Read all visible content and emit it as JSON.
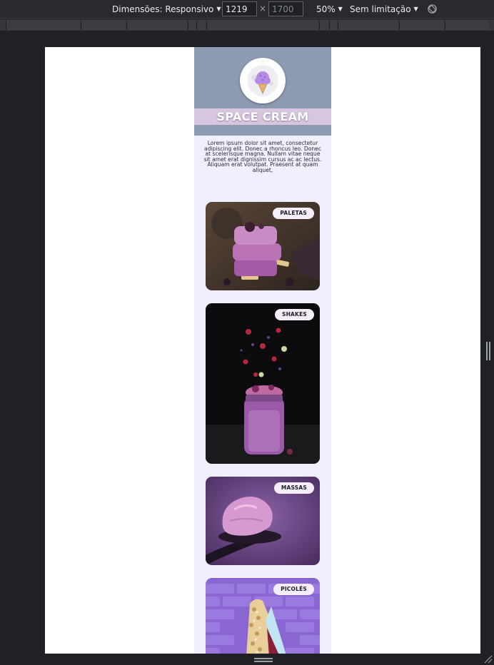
{
  "devtools": {
    "dimensions_label": "Dimensões: Responsivo",
    "width_value": "1219",
    "height_placeholder": "1700",
    "times": "×",
    "zoom": "50%",
    "throttle": "Sem limitação"
  },
  "site": {
    "brand": "SPACE CREAM",
    "intro": "Lorem ipsum dolor sit amet, consectetur adipiscing elit. Donec a rhoncus leo. Donec at scelerisque magna. Nullam vitae neque sit amet erat dignissim cursus ac ac lectus. Aliquam erat volutpat. Praesent at quam aliquet,",
    "categories": [
      {
        "label": "PALETAS",
        "photo": "popsicle-photo"
      },
      {
        "label": "SHAKES",
        "photo": "milkshake-photo"
      },
      {
        "label": "MASSAS",
        "photo": "ice-cream-scoop-photo"
      },
      {
        "label": "PICOLÉS",
        "photo": "ice-pop-photo"
      }
    ]
  },
  "colors": {
    "header": "#8c9bb1",
    "brand_band": "#d7c6df",
    "page_bg": "#f0effd",
    "badge_bg": "#f6eefa"
  }
}
